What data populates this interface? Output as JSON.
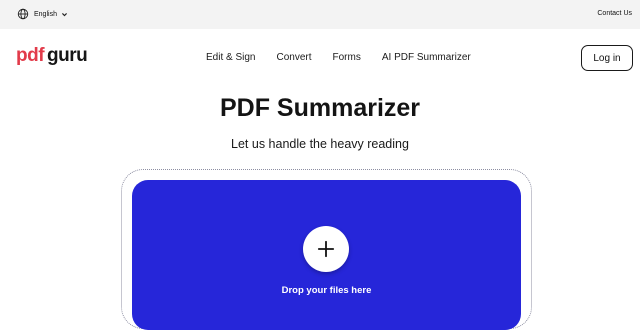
{
  "topbar": {
    "language": "English",
    "contact": "Contact Us"
  },
  "header": {
    "logo_part1": "pdf",
    "logo_part2": "guru",
    "nav": [
      "Edit & Sign",
      "Convert",
      "Forms",
      "AI PDF Summarizer"
    ],
    "login": "Log in"
  },
  "main": {
    "title": "PDF Summarizer",
    "subtitle": "Let us handle the heavy reading",
    "drop_text": "Drop your files here"
  },
  "colors": {
    "brand_red": "#e23b4a",
    "drop_blue": "#2626d9"
  },
  "icons": [
    "globe-icon",
    "chevron-down-icon",
    "plus-icon"
  ]
}
